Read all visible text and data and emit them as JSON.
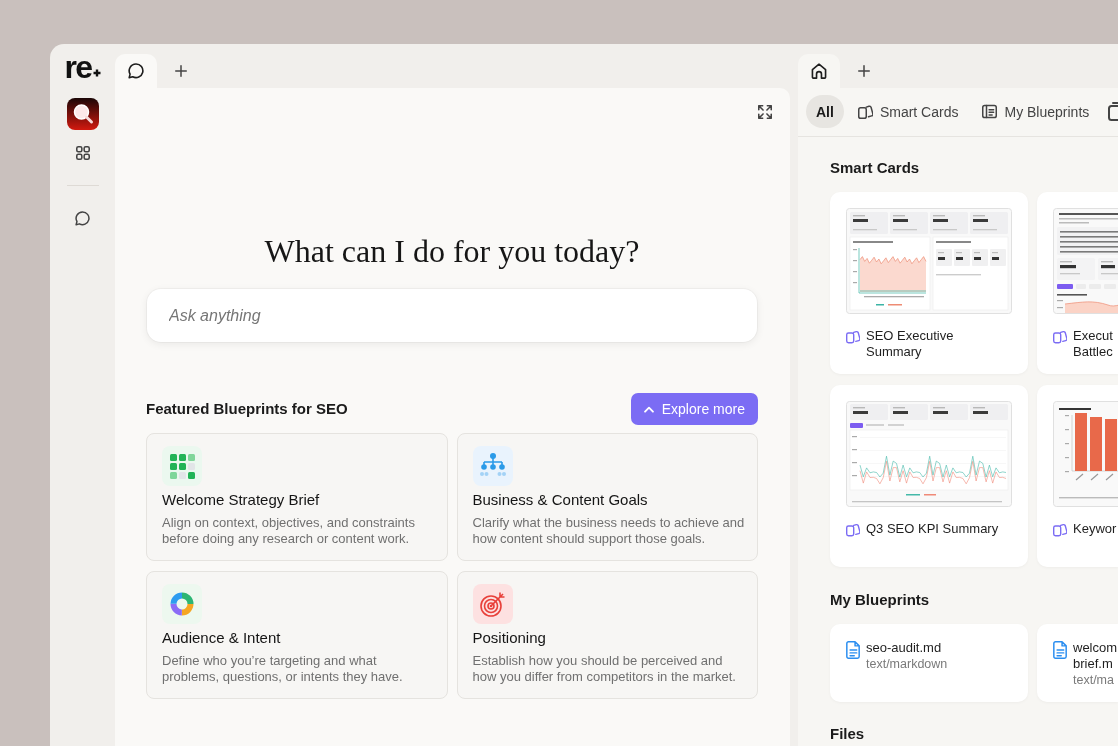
{
  "sidebar": {
    "logo": "re",
    "apps": [
      {
        "kind": "magnifier"
      },
      {
        "kind": "grid"
      }
    ],
    "items": [
      {
        "kind": "chat"
      }
    ]
  },
  "chat_pane": {
    "tabs": [
      {
        "kind": "chat",
        "selected": true
      }
    ],
    "heading": "What can I do for you today?",
    "input": {
      "placeholder": "Ask anything"
    },
    "featured": {
      "title": "Featured Blueprints for SEO",
      "button": "Explore more",
      "cards": [
        {
          "kind": "grid",
          "title": "Welcome Strategy Brief",
          "description": "Align on context, objectives, and constraints before doing any research or content work."
        },
        {
          "kind": "hierarchy",
          "title": "Business & Content Goals",
          "description": "Clarify what the business needs to achieve and how content should support those goals."
        },
        {
          "kind": "ring",
          "title": "Audience & Intent",
          "description": "Define who you’re targeting and what problems, questions, or intents they have."
        },
        {
          "kind": "target",
          "title": "Positioning",
          "description": "Establish how you should be perceived and how you differ from competitors in the market."
        }
      ]
    }
  },
  "library_pane": {
    "tabs": [
      {
        "kind": "home",
        "selected": true
      }
    ],
    "filters": [
      {
        "label": "All",
        "selected": true
      },
      {
        "label": "Smart Cards",
        "kind": "cards",
        "selected": false
      },
      {
        "label": "My Blueprints",
        "kind": "blueprint",
        "selected": false
      },
      {
        "kind": "files",
        "selected": false
      }
    ],
    "smart_cards": {
      "title": "Smart Cards",
      "cards": [
        {
          "kind": "summary",
          "title": "SEO Executive Summary"
        },
        {
          "kind": "battlecard",
          "title": "Execut Battlec"
        },
        {
          "kind": "kpi",
          "title": "Q3 SEO KPI Summary"
        },
        {
          "kind": "bars",
          "title": "Keywor"
        }
      ]
    },
    "blueprints": {
      "title": "My Blueprints",
      "files": [
        {
          "name": "seo-audit.md",
          "type": "text/markdown"
        },
        {
          "name": "welcom brief.m",
          "type": "text/ma"
        }
      ]
    },
    "files": {
      "title": "Files"
    }
  }
}
